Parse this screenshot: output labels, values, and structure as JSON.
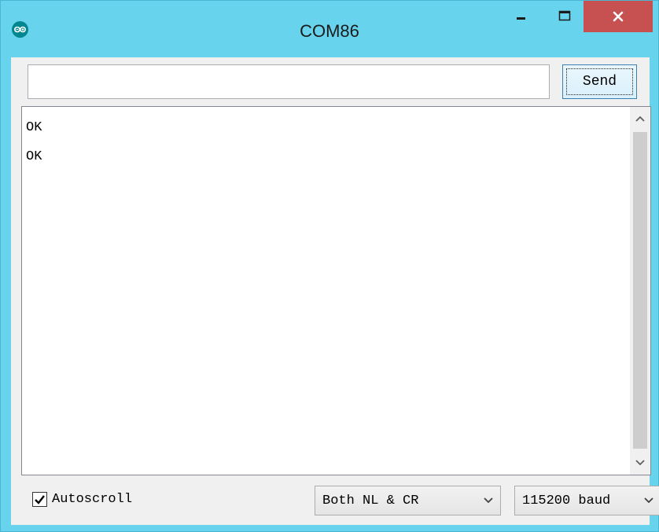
{
  "window": {
    "title": "COM86",
    "app_icon": "arduino-infinity-icon",
    "controls": [
      "minimize-icon",
      "maximize-icon",
      "close-icon"
    ],
    "colors": {
      "titlebar": "#68d3ec",
      "close": "#c75050"
    }
  },
  "input": {
    "value": "",
    "placeholder": ""
  },
  "send_button": {
    "label": "Send"
  },
  "output": {
    "lines": [
      "OK",
      "OK"
    ]
  },
  "footer": {
    "autoscroll": {
      "label": "Autoscroll",
      "checked": true
    },
    "line_ending": {
      "selected": "Both NL & CR"
    },
    "baud_rate": {
      "selected": "115200 baud"
    }
  }
}
